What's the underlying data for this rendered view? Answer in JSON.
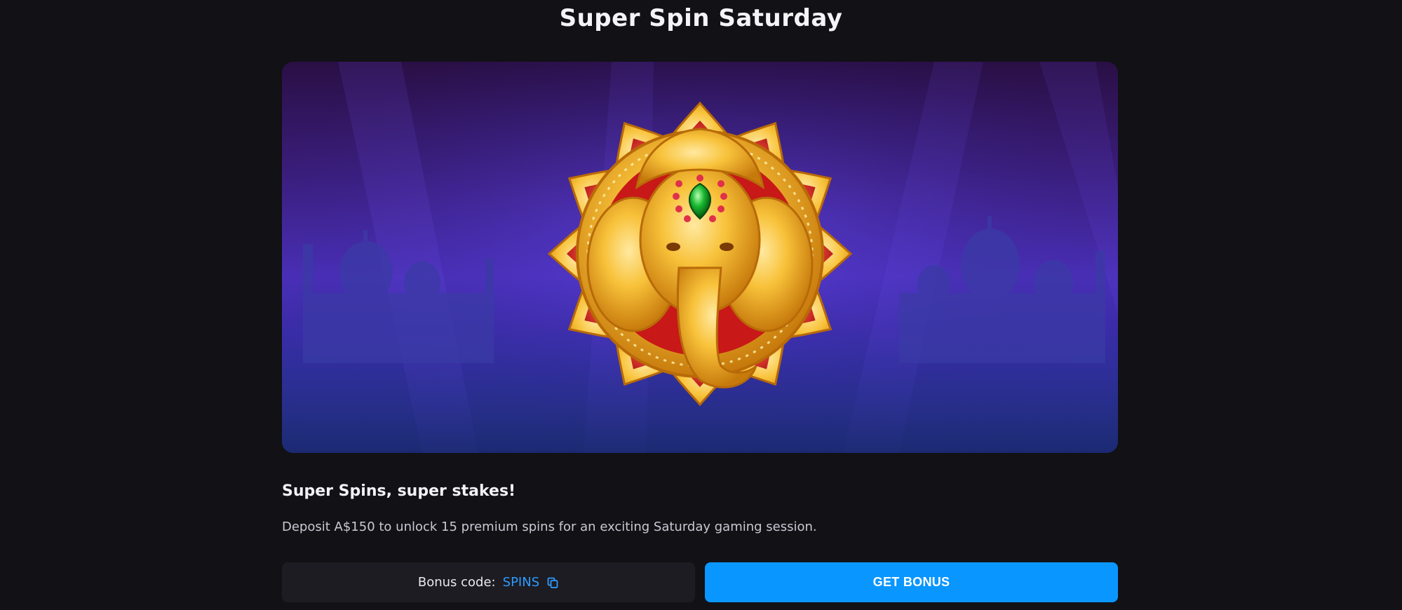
{
  "page": {
    "title": "Super Spin Saturday"
  },
  "hero": {
    "image_subject": "golden-ganesha-emblem"
  },
  "promo": {
    "subtitle": "Super Spins, super stakes!",
    "description": "Deposit A$150 to unlock 15 premium spins for an exciting Saturday gaming session."
  },
  "bonus": {
    "code_label": "Bonus code:",
    "code_value": "SPINS",
    "copy_icon": "copy-icon",
    "button_label": "GET BONUS"
  },
  "colors": {
    "background": "#111116",
    "accent": "#0a96ff",
    "code_text": "#2f9bff",
    "panel": "#1c1c22"
  }
}
